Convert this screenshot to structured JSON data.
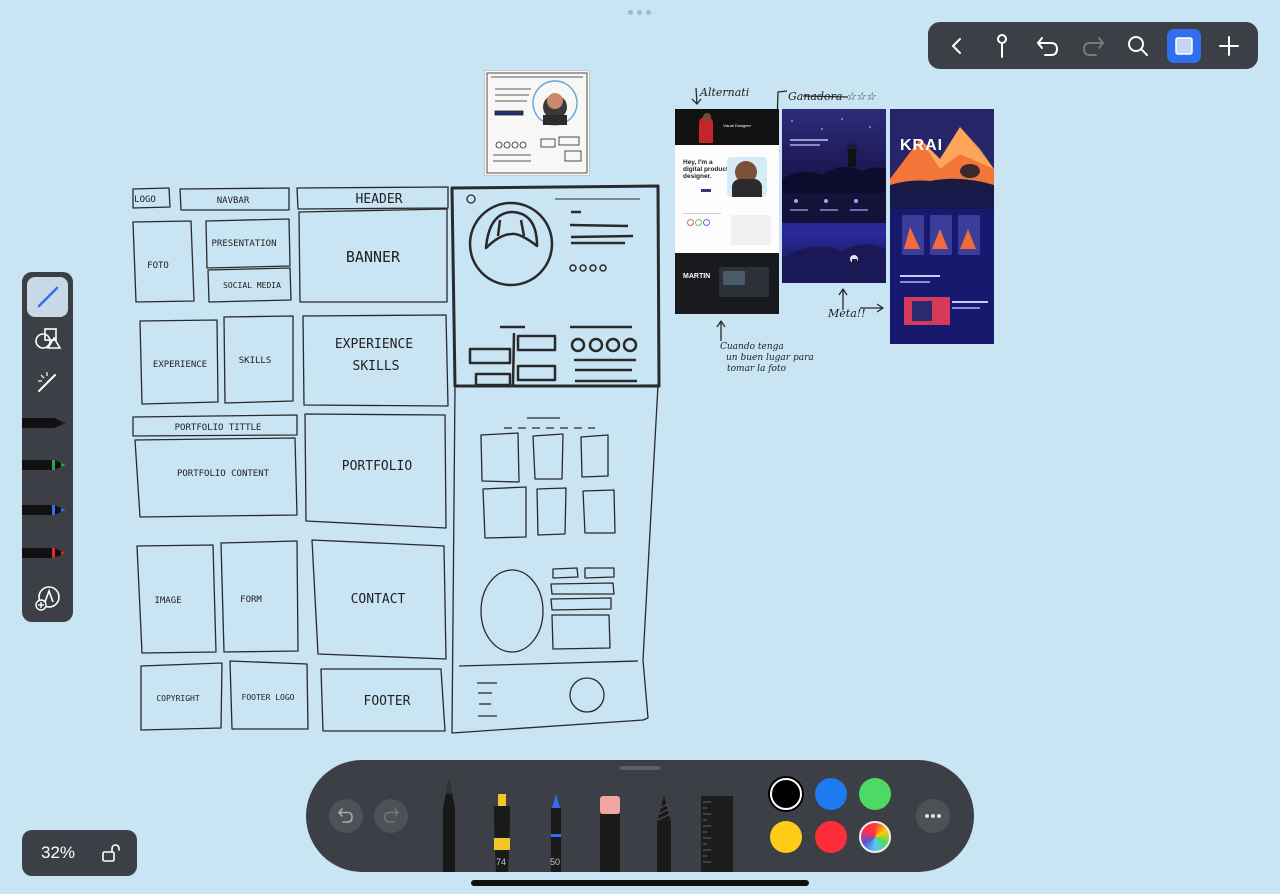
{
  "app": {
    "zoom": "32%"
  },
  "top_toolbar": {
    "buttons": [
      "back-icon",
      "pin-icon",
      "undo-icon",
      "redo-icon",
      "search-icon",
      "canvas-select-icon",
      "add-icon"
    ]
  },
  "left_palette": {
    "tools": [
      "pencil",
      "shapes",
      "magic-wand",
      "black-pen",
      "green-pen",
      "blue-pen",
      "red-pen",
      "add-tool"
    ]
  },
  "bottom_bar": {
    "marker_size": "74",
    "pen_size": "50",
    "swatches": {
      "black": "#000000",
      "blue": "#1e7af0",
      "green": "#4cd964",
      "yellow": "#ffcc1a",
      "red": "#ff2d3a"
    }
  },
  "wireframe": {
    "logo": "LOGO",
    "navbar": "NAVBAR",
    "header": "HEADER",
    "foto": "FOTO",
    "presentation": "PRESENTATION",
    "social_media": "SOCIAL MEDIA",
    "banner": "BANNER",
    "experience": "EXPERIENCE",
    "skills": "SKILLS",
    "experience_skills_1": "EXPERIENCE",
    "experience_skills_2": "SKILLS",
    "portfolio_title": "PORTFOLIO TITTLE",
    "portfolio_content": "PORTFOLIO CONTENT",
    "portfolio": "PORTFOLIO",
    "image": "IMAGE",
    "form": "FORM",
    "contact": "CONTACT",
    "copyright": "COPYRIGHT",
    "footer_logo": "FOOTER LOGO",
    "footer": "FOOTER"
  },
  "notes": {
    "alternativa": "Alternati",
    "ganadora": "Ganadora ☆☆☆",
    "meta": "Meta!!",
    "cuando_1": "Cuando tenga",
    "cuando_2": "un buen lugar para",
    "cuando_3": "tomar la foto"
  },
  "references": {
    "ref1_heading": "Hey, I'm a digital product designer.",
    "ref1_top": "Visual Designer",
    "ref1_bottom": "MARTIN",
    "ref3_title": "KRAI"
  }
}
